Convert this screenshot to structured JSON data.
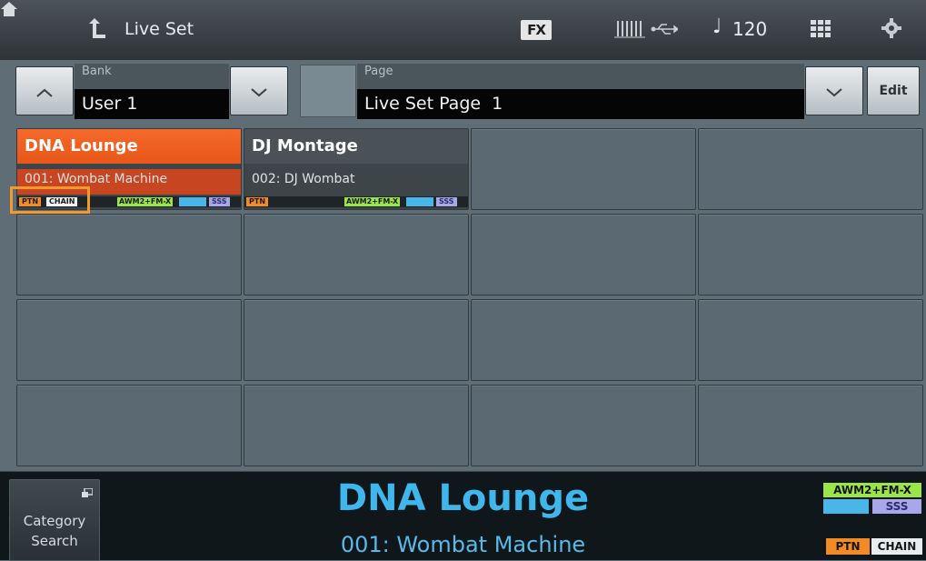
{
  "topbar": {
    "title": "Live Set",
    "fx_label": "FX",
    "tempo_note": "♩",
    "tempo": "120",
    "icons": [
      "home-icon",
      "up-arrow-icon",
      "fx-icon",
      "midi-icon",
      "usb-icon",
      "grid-icon",
      "gear-icon"
    ]
  },
  "selector": {
    "bank_label": "Bank",
    "bank_value": "User 1",
    "page_label": "Page",
    "page_value": "Live Set Page  1",
    "edit_label": "Edit"
  },
  "slots": [
    {
      "title": "DNA Lounge",
      "subtitle": "001: Wombat Machine",
      "state": "selected",
      "badges": {
        "ptn": "PTN",
        "chain": "CHAIN",
        "awm": "AWM2+FM-X",
        "sss": "SSS"
      }
    },
    {
      "title": "DJ Montage",
      "subtitle": "002: DJ Wombat",
      "state": "filled",
      "badges": {
        "ptn": "PTN",
        "chain": "",
        "awm": "AWM2+FM-X",
        "sss": "SSS"
      }
    }
  ],
  "bottom": {
    "category_search_label": "Category\nSearch",
    "performance_name": "DNA Lounge",
    "performance_sub": "001: Wombat Machine",
    "awm_badge": "AWM2+FM-X",
    "sss_badge": "SSS",
    "ptn_badge": "PTN",
    "chain_badge": "CHAIN"
  },
  "colors": {
    "accent": "#f26a2a",
    "performance_text": "#3fb7ec",
    "focus": "#f29a2e"
  }
}
